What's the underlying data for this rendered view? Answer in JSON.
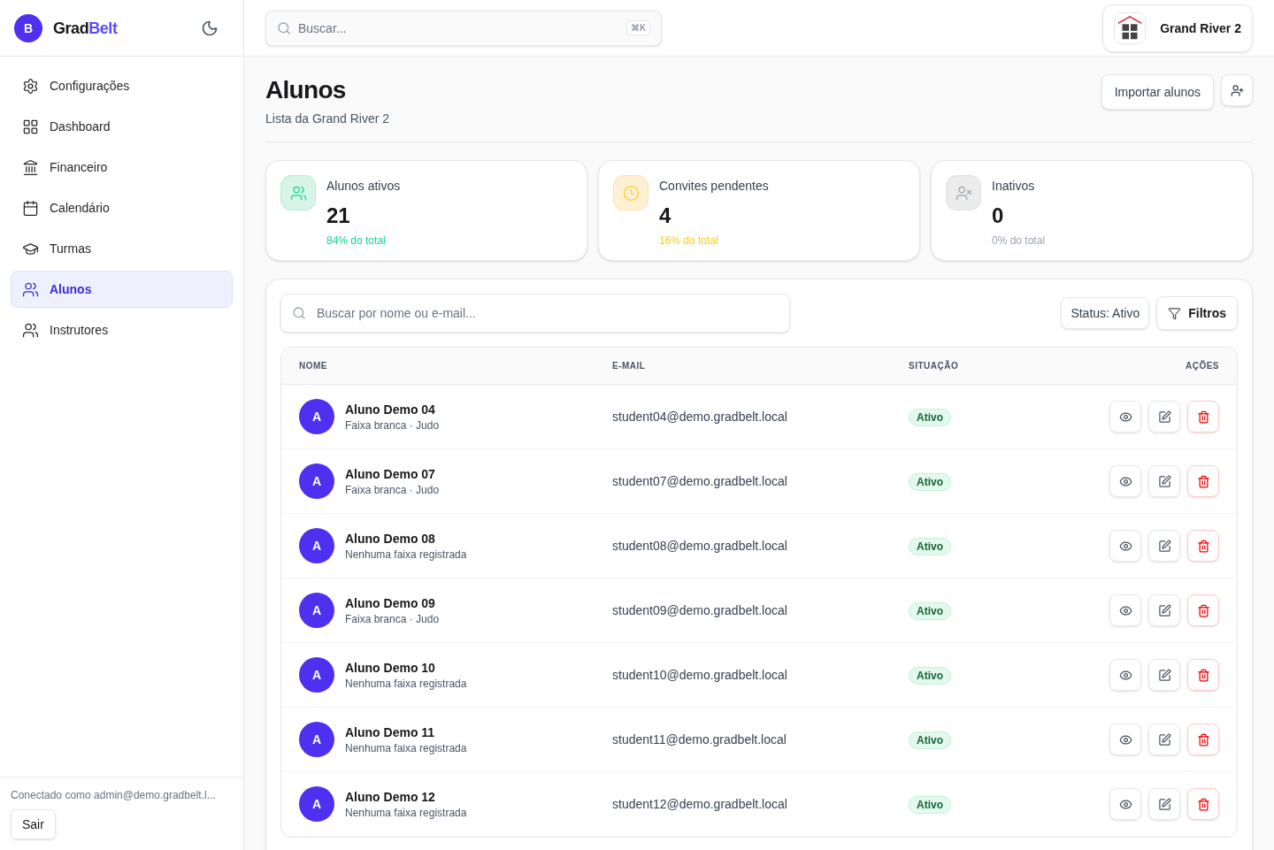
{
  "brand": {
    "avatar": "B",
    "name_part1": "Grad",
    "name_part2": "Belt"
  },
  "sidebar": {
    "items": [
      {
        "label": "Configurações",
        "kind": "settings",
        "selected": false
      },
      {
        "label": "Dashboard",
        "kind": "dashboard",
        "selected": false
      },
      {
        "label": "Financeiro",
        "kind": "finance",
        "selected": false
      },
      {
        "label": "Calendário",
        "kind": "calendar",
        "selected": false
      },
      {
        "label": "Turmas",
        "kind": "classes",
        "selected": false
      },
      {
        "label": "Alunos",
        "kind": "students",
        "selected": true
      },
      {
        "label": "Instrutores",
        "kind": "instructors",
        "selected": false
      }
    ],
    "footer": {
      "text": "Conectado como admin@demo.gradbelt.l...",
      "button": "Sair"
    }
  },
  "topbar": {
    "search": {
      "placeholder": "Buscar...",
      "shortcut": "⌘K"
    },
    "school": "Grand River 2"
  },
  "page": {
    "title": "Alunos",
    "subtitle": "Lista da Grand River 2",
    "buttons": [
      "Importar alunos"
    ]
  },
  "stats": [
    {
      "kind": "active",
      "label": "Alunos ativos",
      "value": "21",
      "note": "84% do total",
      "color": "#10d98a"
    },
    {
      "kind": "pending",
      "label": "Convites pendentes",
      "value": "4",
      "note": "16% do total",
      "color": "#facc15"
    },
    {
      "kind": "inactive",
      "label": "Inativos",
      "value": "0",
      "note": "0% do total",
      "color": "#9ca3af"
    }
  ],
  "table": {
    "search": {
      "placeholder": "Buscar por nome ou e-mail..."
    },
    "status_filter": "Status: Ativo",
    "filters_button": "Filtros",
    "columns": [
      "NOME",
      "E-MAIL",
      "SITUAÇÃO",
      "AÇÕES"
    ],
    "rows": [
      {
        "avatar": "A",
        "name": "Aluno Demo 04",
        "detail": "Faixa branca · Judo",
        "email": "student04@demo.gradbelt.local",
        "status": "Ativo"
      },
      {
        "avatar": "A",
        "name": "Aluno Demo 07",
        "detail": "Faixa branca · Judo",
        "email": "student07@demo.gradbelt.local",
        "status": "Ativo"
      },
      {
        "avatar": "A",
        "name": "Aluno Demo 08",
        "detail": "Nenhuma faixa registrada",
        "email": "student08@demo.gradbelt.local",
        "status": "Ativo"
      },
      {
        "avatar": "A",
        "name": "Aluno Demo 09",
        "detail": "Faixa branca · Judo",
        "email": "student09@demo.gradbelt.local",
        "status": "Ativo"
      },
      {
        "avatar": "A",
        "name": "Aluno Demo 10",
        "detail": "Nenhuma faixa registrada",
        "email": "student10@demo.gradbelt.local",
        "status": "Ativo"
      },
      {
        "avatar": "A",
        "name": "Aluno Demo 11",
        "detail": "Nenhuma faixa registrada",
        "email": "student11@demo.gradbelt.local",
        "status": "Ativo"
      },
      {
        "avatar": "A",
        "name": "Aluno Demo 12",
        "detail": "Nenhuma faixa registrada",
        "email": "student12@demo.gradbelt.local",
        "status": "Ativo"
      }
    ]
  }
}
